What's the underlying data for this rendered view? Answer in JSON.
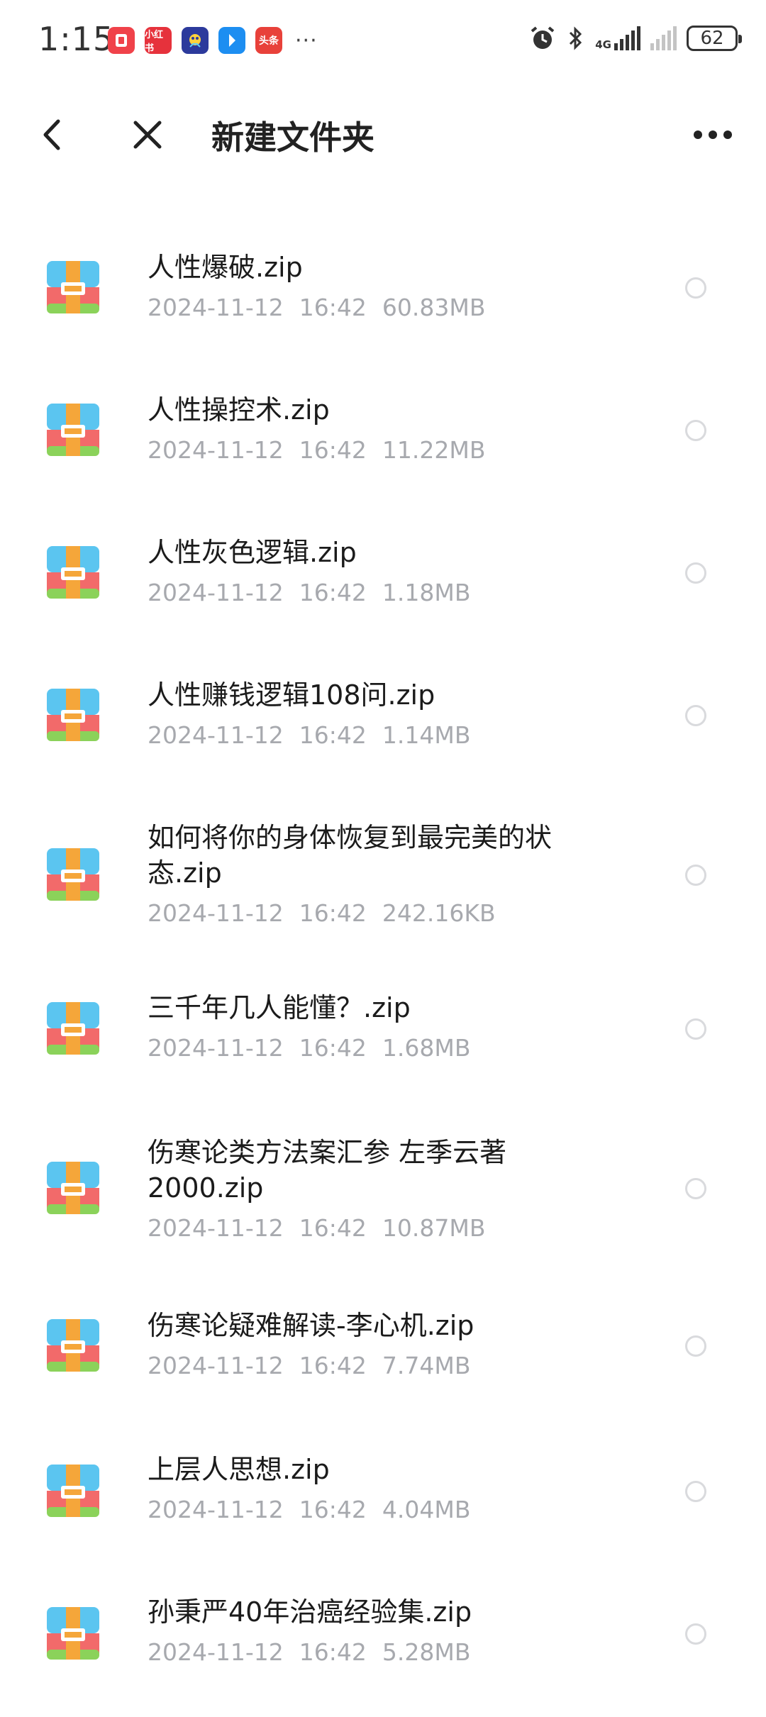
{
  "status_bar": {
    "time": "1:15",
    "app_icons": [
      {
        "name": "app-red-icon",
        "label": ""
      },
      {
        "name": "xiaohongshu-icon",
        "label": "小红书"
      },
      {
        "name": "game-app-icon",
        "label": ""
      },
      {
        "name": "blue-app-icon",
        "label": ""
      },
      {
        "name": "toutiao-icon",
        "label": "头条"
      }
    ],
    "more": "···",
    "network_label": "4G",
    "battery": "62"
  },
  "header": {
    "title": "新建文件夹"
  },
  "files": [
    {
      "name": "人性爆破.zip",
      "date": "2024-11-12",
      "time": "16:42",
      "size": "60.83MB"
    },
    {
      "name": "人性操控术.zip",
      "date": "2024-11-12",
      "time": "16:42",
      "size": "11.22MB"
    },
    {
      "name": "人性灰色逻辑.zip",
      "date": "2024-11-12",
      "time": "16:42",
      "size": "1.18MB"
    },
    {
      "name": "人性赚钱逻辑108问.zip",
      "date": "2024-11-12",
      "time": "16:42",
      "size": "1.14MB"
    },
    {
      "name": "如何将你的身体恢复到最完美的状态.zip",
      "date": "2024-11-12",
      "time": "16:42",
      "size": "242.16KB"
    },
    {
      "name": "三千年几人能懂？.zip",
      "date": "2024-11-12",
      "time": "16:42",
      "size": "1.68MB"
    },
    {
      "name": "伤寒论类方法案汇参 左季云著2000.zip",
      "date": "2024-11-12",
      "time": "16:42",
      "size": "10.87MB"
    },
    {
      "name": "伤寒论疑难解读-李心机.zip",
      "date": "2024-11-12",
      "time": "16:42",
      "size": "7.74MB"
    },
    {
      "name": "上层人思想.zip",
      "date": "2024-11-12",
      "time": "16:42",
      "size": "4.04MB"
    },
    {
      "name": "孙秉严40年治癌经验集.zip",
      "date": "2024-11-12",
      "time": "16:42",
      "size": "5.28MB"
    }
  ]
}
